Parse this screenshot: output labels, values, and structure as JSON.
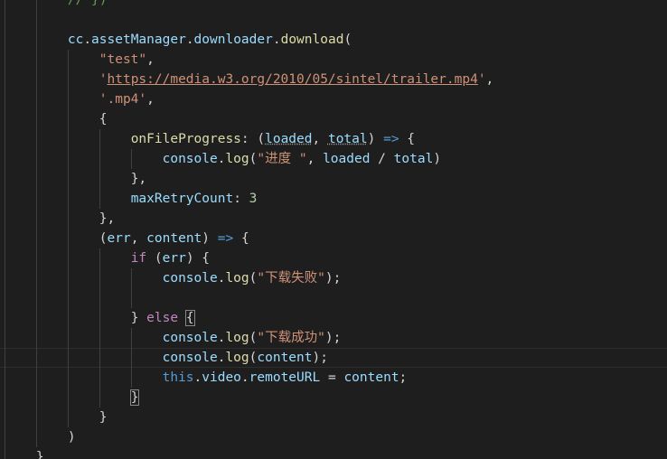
{
  "editor": {
    "lines": [
      [
        {
          "t": "        "
        },
        {
          "t": "// })",
          "c": "comment"
        }
      ],
      [],
      [
        {
          "t": "        "
        },
        {
          "t": "cc",
          "c": "var"
        },
        {
          "t": "."
        },
        {
          "t": "assetManager",
          "c": "var"
        },
        {
          "t": "."
        },
        {
          "t": "downloader",
          "c": "var"
        },
        {
          "t": "."
        },
        {
          "t": "download",
          "c": "fn"
        },
        {
          "t": "("
        }
      ],
      [
        {
          "t": "            "
        },
        {
          "t": "\"test\"",
          "c": "str"
        },
        {
          "t": ","
        }
      ],
      [
        {
          "t": "            "
        },
        {
          "t": "'",
          "c": "str"
        },
        {
          "t": "https://media.w3.org/2010/05/sintel/trailer.mp4",
          "c": "url"
        },
        {
          "t": "'",
          "c": "str"
        },
        {
          "t": ","
        }
      ],
      [
        {
          "t": "            "
        },
        {
          "t": "'.mp4'",
          "c": "str"
        },
        {
          "t": ","
        }
      ],
      [
        {
          "t": "            "
        },
        {
          "t": "{"
        }
      ],
      [
        {
          "t": "                "
        },
        {
          "t": "onFileProgress",
          "c": "fn"
        },
        {
          "t": ": ("
        },
        {
          "t": "loaded",
          "c": "var dotted"
        },
        {
          "t": ", "
        },
        {
          "t": "total",
          "c": "var dotted"
        },
        {
          "t": ") "
        },
        {
          "t": "=>",
          "c": "arrow"
        },
        {
          "t": " {"
        }
      ],
      [
        {
          "t": "                    "
        },
        {
          "t": "console",
          "c": "var"
        },
        {
          "t": "."
        },
        {
          "t": "log",
          "c": "fn"
        },
        {
          "t": "("
        },
        {
          "t": "\"进度 \"",
          "c": "str"
        },
        {
          "t": ", "
        },
        {
          "t": "loaded",
          "c": "var"
        },
        {
          "t": " / "
        },
        {
          "t": "total",
          "c": "var"
        },
        {
          "t": ")"
        }
      ],
      [
        {
          "t": "                "
        },
        {
          "t": "},"
        }
      ],
      [
        {
          "t": "                "
        },
        {
          "t": "maxRetryCount",
          "c": "var"
        },
        {
          "t": ": "
        },
        {
          "t": "3",
          "c": "num"
        }
      ],
      [
        {
          "t": "            "
        },
        {
          "t": "},"
        }
      ],
      [
        {
          "t": "            "
        },
        {
          "t": "("
        },
        {
          "t": "err",
          "c": "var"
        },
        {
          "t": ", "
        },
        {
          "t": "content",
          "c": "var"
        },
        {
          "t": ") "
        },
        {
          "t": "=>",
          "c": "arrow"
        },
        {
          "t": " {"
        }
      ],
      [
        {
          "t": "                "
        },
        {
          "t": "if",
          "c": "key"
        },
        {
          "t": " ("
        },
        {
          "t": "err",
          "c": "var"
        },
        {
          "t": ") {"
        }
      ],
      [
        {
          "t": "                    "
        },
        {
          "t": "console",
          "c": "var"
        },
        {
          "t": "."
        },
        {
          "t": "log",
          "c": "fn"
        },
        {
          "t": "("
        },
        {
          "t": "\"下载失败\"",
          "c": "str"
        },
        {
          "t": ");"
        }
      ],
      [],
      [
        {
          "t": "                "
        },
        {
          "t": "} "
        },
        {
          "t": "else",
          "c": "key"
        },
        {
          "t": " "
        },
        {
          "t": "{",
          "c": "match"
        }
      ],
      [
        {
          "t": "                    "
        },
        {
          "t": "console",
          "c": "var"
        },
        {
          "t": "."
        },
        {
          "t": "log",
          "c": "fn"
        },
        {
          "t": "("
        },
        {
          "t": "\"下载成功\"",
          "c": "str"
        },
        {
          "t": ");"
        }
      ],
      [
        {
          "t": "                    "
        },
        {
          "t": "console",
          "c": "var"
        },
        {
          "t": "."
        },
        {
          "t": "log",
          "c": "fn"
        },
        {
          "t": "("
        },
        {
          "t": "content",
          "c": "var"
        },
        {
          "t": ");"
        }
      ],
      [
        {
          "t": "                    "
        },
        {
          "t": "this",
          "c": "this"
        },
        {
          "t": "."
        },
        {
          "t": "video",
          "c": "var"
        },
        {
          "t": "."
        },
        {
          "t": "remoteURL",
          "c": "var"
        },
        {
          "t": " = "
        },
        {
          "t": "content",
          "c": "var"
        },
        {
          "t": ";"
        }
      ],
      [
        {
          "t": "                "
        },
        {
          "t": "}",
          "c": "match"
        }
      ],
      [
        {
          "t": "            "
        },
        {
          "t": "}"
        }
      ],
      [
        {
          "t": "        "
        },
        {
          "t": ")"
        }
      ],
      [
        {
          "t": "    "
        },
        {
          "t": "}"
        }
      ]
    ],
    "cursor_line": 18
  },
  "colors": {
    "background": "#1e1e1e",
    "comment": "#6a9955",
    "variable": "#9cdcfe",
    "function": "#dcdcaa",
    "string": "#ce9178",
    "keyword": "#c586c0",
    "this_keyword": "#569cd6",
    "number": "#b5cea8",
    "punctuation": "#d4d4d4"
  }
}
